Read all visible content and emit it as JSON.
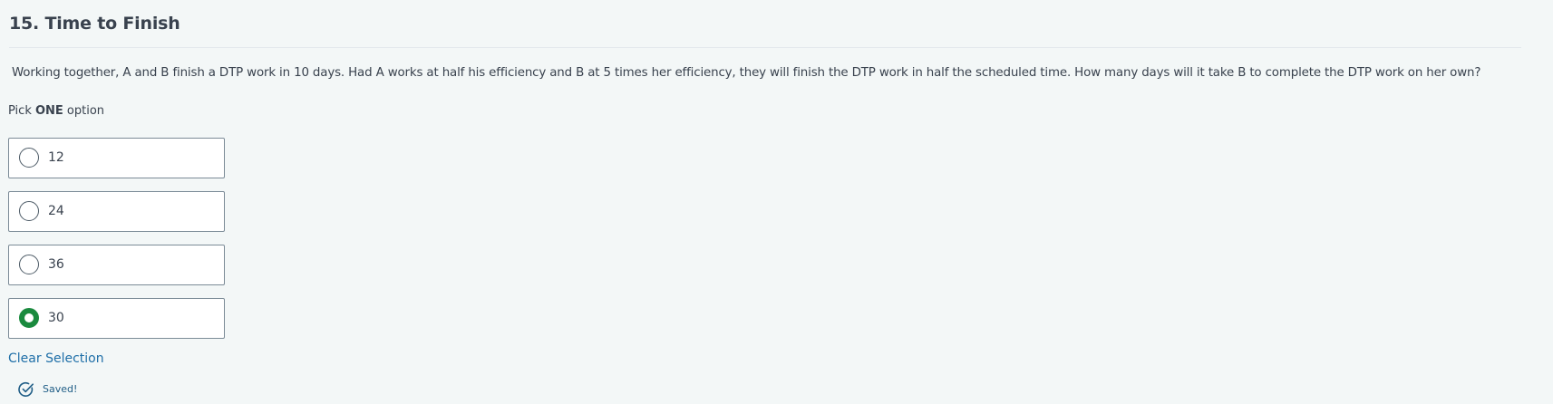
{
  "question": {
    "title": "15. Time to Finish",
    "text": "Working together, A and B finish a DTP work in 10 days. Had A works at half his efficiency and B at 5 times her efficiency, they will finish the DTP work in half the scheduled time. How many days will it take B to complete the DTP work on her own?",
    "instruction_prefix": "Pick ",
    "instruction_bold": "ONE",
    "instruction_suffix": " option"
  },
  "options": [
    {
      "label": "12",
      "selected": false
    },
    {
      "label": "24",
      "selected": false
    },
    {
      "label": "36",
      "selected": false
    },
    {
      "label": "30",
      "selected": true
    }
  ],
  "actions": {
    "clear_label": "Clear Selection"
  },
  "status": {
    "saved_label": "Saved!",
    "icon": "check-circle-icon"
  },
  "colors": {
    "selected_radio": "#1a8a3e",
    "link": "#1f6fa8",
    "saved_text": "#1f5d86",
    "text": "#39424e",
    "background": "#f3f7f7"
  }
}
